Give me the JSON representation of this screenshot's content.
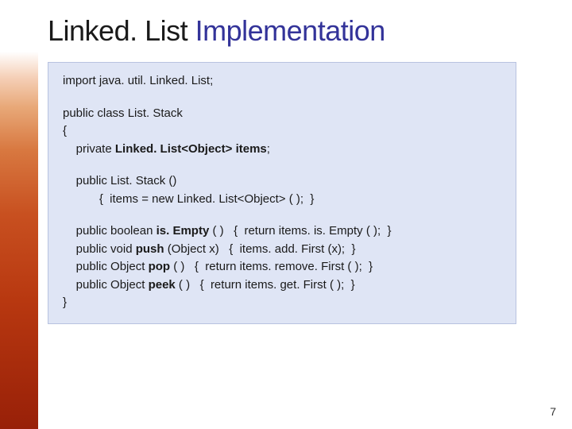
{
  "title": {
    "part1": "Linked. List ",
    "part2": "Implementation"
  },
  "code": {
    "l01": "import java. util. Linked. List;",
    "l02": "public class List. Stack",
    "l03": "{",
    "l04_a": "    private ",
    "l04_b": "Linked. List<Object> items",
    "l04_c": ";",
    "l05": "    public List. Stack ()",
    "l06": "           {  items = new Linked. List<Object> ( );  }",
    "l07_a": "    public boolean ",
    "l07_b": "is. Empty",
    "l07_c": " ( )   {  return items. is. Empty ( );  }",
    "l08_a": "    public void ",
    "l08_b": "push",
    "l08_c": " (Object x)   {  items. add. First (x);  }",
    "l09_a": "    public Object ",
    "l09_b": "pop",
    "l09_c": " ( )   {  return items. remove. First ( );  }",
    "l10_a": "    public Object ",
    "l10_b": "peek",
    "l10_c": " ( )   {  return items. get. First ( );  }",
    "l11": "}"
  },
  "page_number": "7"
}
